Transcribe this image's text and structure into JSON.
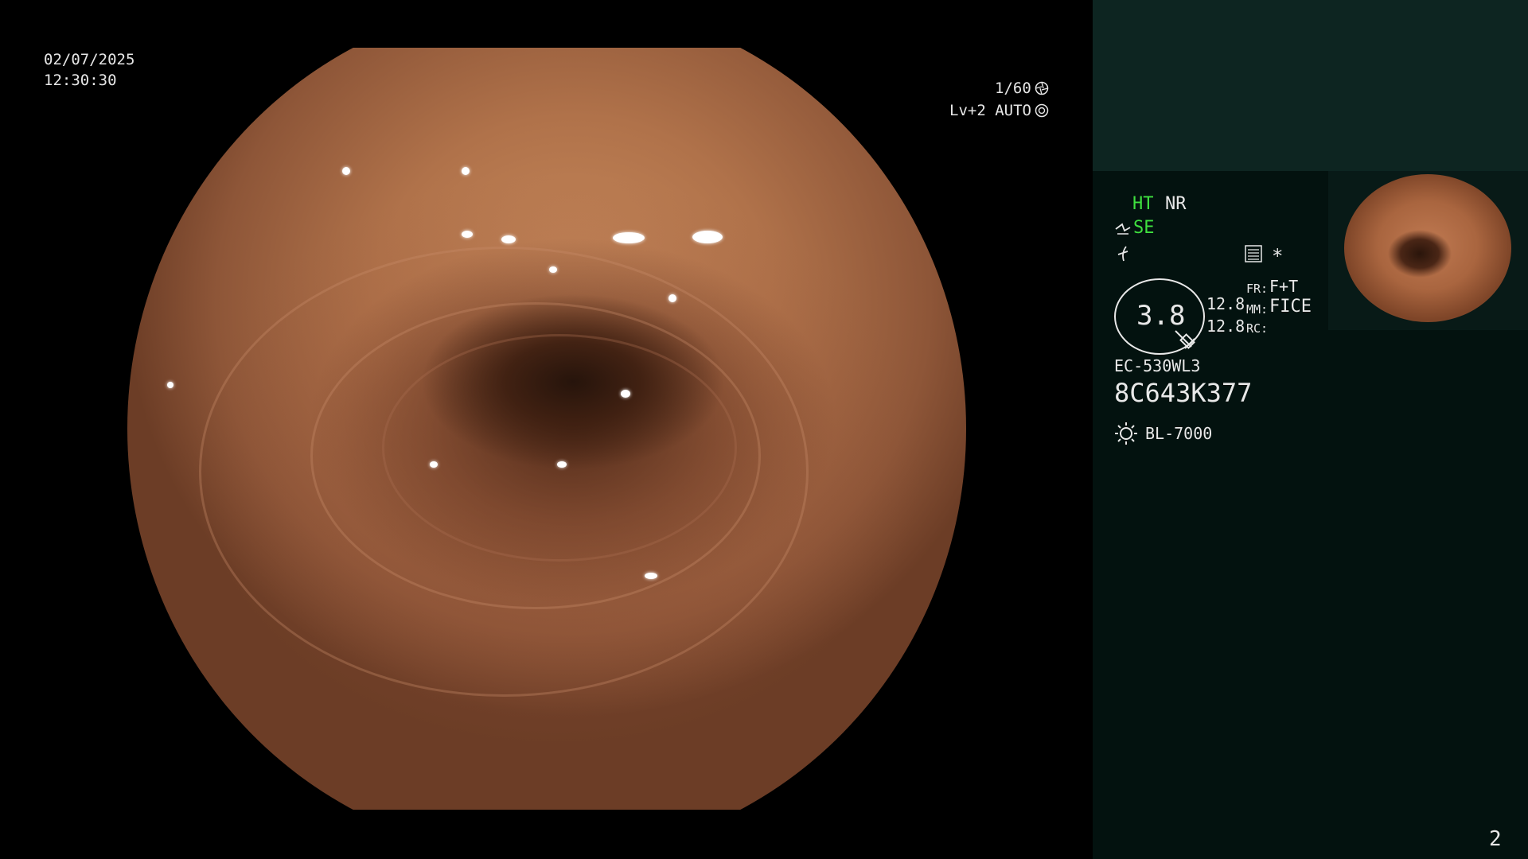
{
  "main": {
    "date": "02/07/2025",
    "time": "12:30:30",
    "shutter": "1/60",
    "level": "Lv+2 AUTO"
  },
  "panel": {
    "ht": "HT",
    "nr": "NR",
    "se": "SE",
    "star": "*",
    "gauge_value": "3.8",
    "val1": "12.8",
    "val2": "12.8",
    "fr_label": "FR:",
    "fr_value": "F+T",
    "mm_label": "MM:",
    "mm_value": "FICE",
    "rc_label": "RC:",
    "scope_model": "EC-530WL3",
    "scope_serial": "8C643K377",
    "light_source": "BL-7000",
    "page_number": "2"
  }
}
